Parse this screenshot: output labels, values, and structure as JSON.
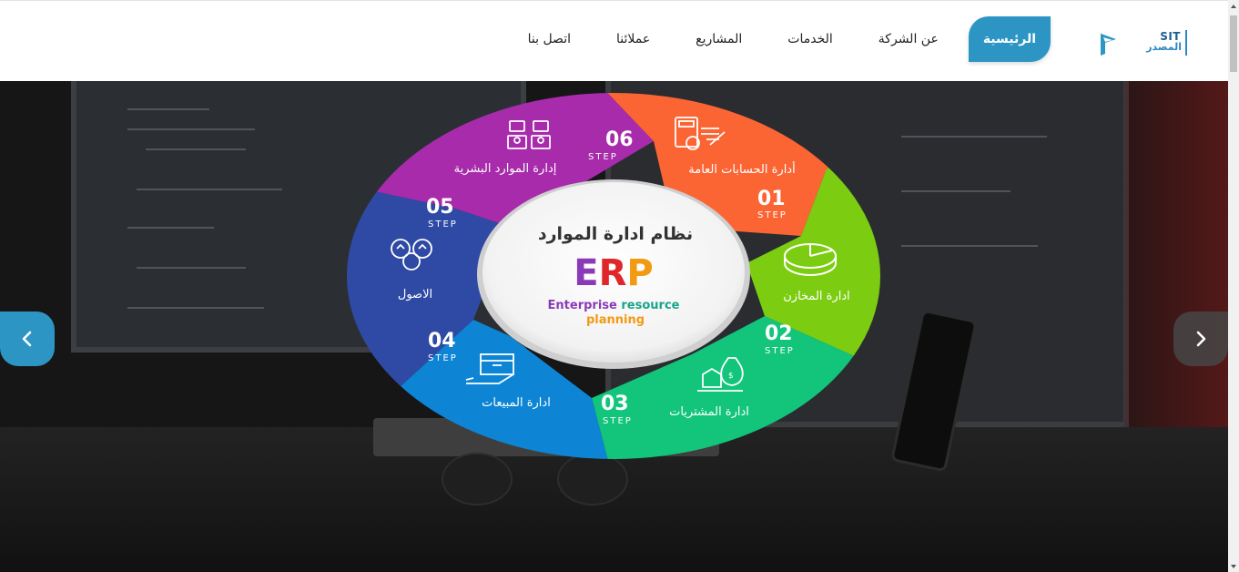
{
  "header": {
    "logo": {
      "latin": "SIT",
      "arabic": "المصدر"
    },
    "nav": [
      {
        "label": "الرئيسية",
        "active": true
      },
      {
        "label": "عن الشركة",
        "active": false
      },
      {
        "label": "الخدمات",
        "active": false
      },
      {
        "label": "المشاريع",
        "active": false
      },
      {
        "label": "عملائنا",
        "active": false
      },
      {
        "label": "اتصل بنا",
        "active": false
      }
    ]
  },
  "slider": {
    "prev_icon": "chevron-left-icon",
    "next_icon": "chevron-right-icon"
  },
  "erp": {
    "title": "نظام ادارة الموارد",
    "acronym": "ERP",
    "subtitle_line1_a": "Enterprise",
    "subtitle_line1_b": "resource",
    "subtitle_line2": "planning",
    "step_word": "STEP",
    "steps": [
      {
        "num": "01",
        "label": "أدارة الحسابات العامة",
        "color": "#fb6534",
        "icon": "accounting-calculator-icon"
      },
      {
        "num": "02",
        "label": "ادارة المخازن",
        "color": "#7ccd12",
        "icon": "pie-chart-icon"
      },
      {
        "num": "03",
        "label": "ادارة المشتريات",
        "color": "#12c57b",
        "icon": "money-bag-icon"
      },
      {
        "num": "04",
        "label": "ادارة المبيعات",
        "color": "#0d85d4",
        "icon": "box-hand-icon"
      },
      {
        "num": "05",
        "label": "الاصول",
        "color": "#2f4aa5",
        "icon": "assets-gears-icon"
      },
      {
        "num": "06",
        "label": "إدارة الموارد البشرية",
        "color": "#a72bab",
        "icon": "org-chart-icon"
      }
    ]
  },
  "colors": {
    "accent": "#2d95c3",
    "erp_e": "#8a3ab9",
    "erp_r": "#e0262b",
    "erp_p": "#f29a12",
    "subtitle_purple": "#8a3ab9",
    "subtitle_green": "#17a589",
    "subtitle_orange": "#f29a12"
  }
}
